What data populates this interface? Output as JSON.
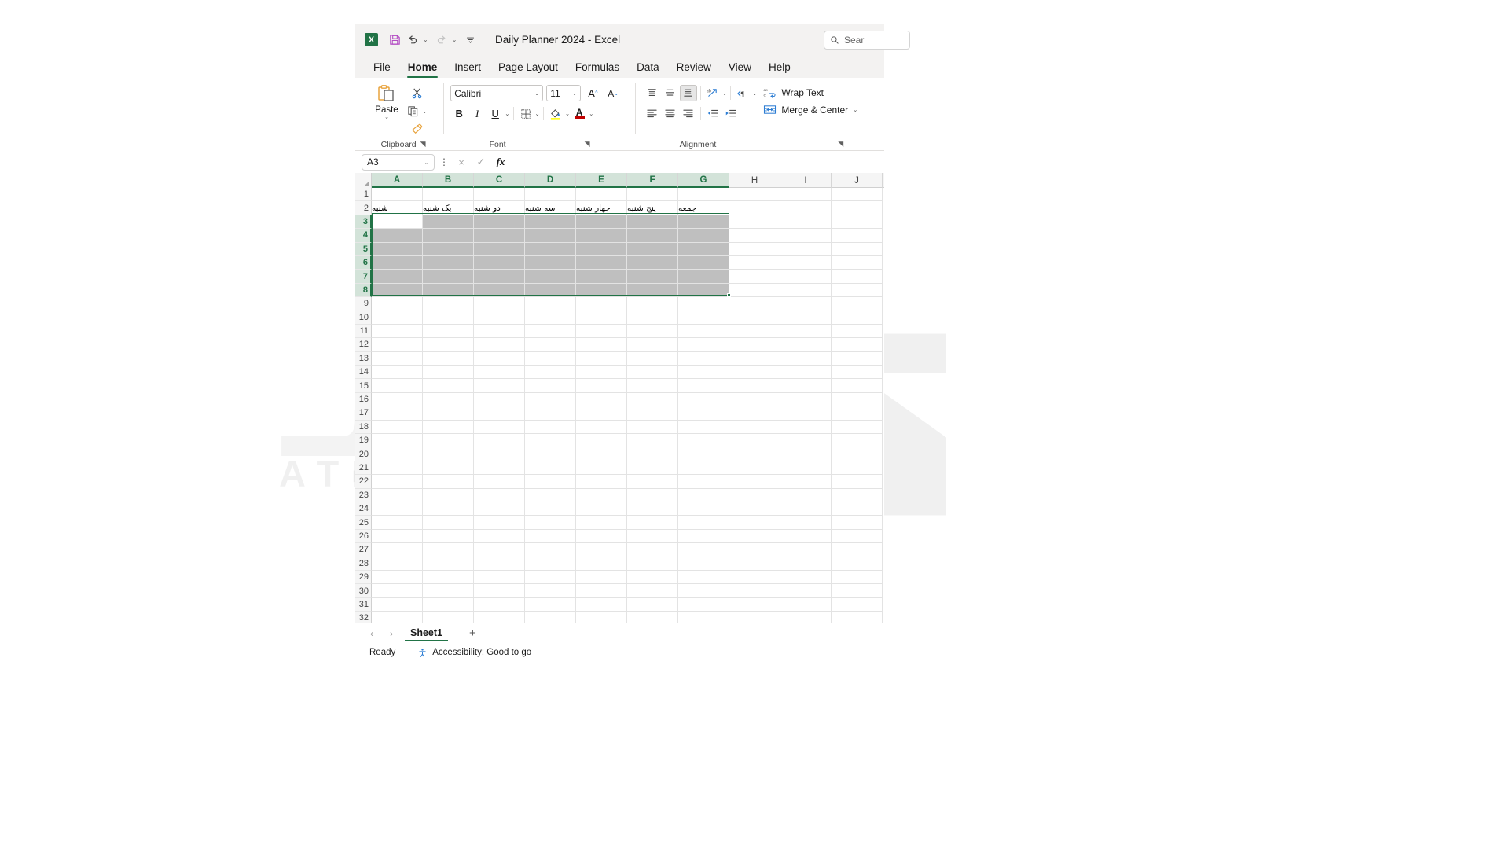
{
  "window": {
    "title": "Daily Planner 2024  -  Excel",
    "app_icon": "excel-icon",
    "app_icon_letter": "X"
  },
  "quick_access": {
    "save_label": "save-icon",
    "undo_label": "undo-icon",
    "redo_label": "redo-icon",
    "customize_label": "customize-quick-access-toolbar-icon"
  },
  "search": {
    "placeholder": "Sear",
    "text": "Sear",
    "icon": "search-icon"
  },
  "tabs": [
    {
      "label": "File",
      "active": false
    },
    {
      "label": "Home",
      "active": true
    },
    {
      "label": "Insert",
      "active": false
    },
    {
      "label": "Page Layout",
      "active": false
    },
    {
      "label": "Formulas",
      "active": false
    },
    {
      "label": "Data",
      "active": false
    },
    {
      "label": "Review",
      "active": false
    },
    {
      "label": "View",
      "active": false
    },
    {
      "label": "Help",
      "active": false
    }
  ],
  "ribbon": {
    "clipboard": {
      "group_label": "Clipboard",
      "paste_label": "Paste",
      "cut_label": "Cut",
      "copy_label": "Copy",
      "format_painter_label": "Format Painter"
    },
    "font": {
      "group_label": "Font",
      "font_name": "Calibri",
      "font_size": "11",
      "bold": "B",
      "italic": "I",
      "underline": "U",
      "grow_font": "A",
      "shrink_font": "A",
      "borders": "borders-icon",
      "fill_color": "fill-color-icon",
      "font_color": "A",
      "fill_color_swatch": "#ffff00",
      "font_color_swatch": "#c00000"
    },
    "alignment": {
      "group_label": "Alignment",
      "align_top": "align-top-icon",
      "align_middle": "align-middle-icon",
      "align_bottom": "align-bottom-icon",
      "orientation": "orientation-icon",
      "align_left": "align-left-icon",
      "align_center": "align-center-icon",
      "align_right": "align-right-icon",
      "decrease_indent": "decrease-indent-icon",
      "increase_indent": "increase-indent-icon",
      "wrap_text_label": "Wrap Text",
      "merge_center_label": "Merge & Center"
    }
  },
  "formula_bar": {
    "name_box": "A3",
    "cancel": "×",
    "enter": "✓",
    "function": "fx",
    "formula_value": ""
  },
  "grid": {
    "columns": [
      "A",
      "B",
      "C",
      "D",
      "E",
      "F",
      "G",
      "H",
      "I",
      "J"
    ],
    "selected_columns": [
      "A",
      "B",
      "C",
      "D",
      "E",
      "F",
      "G"
    ],
    "row_count": 33,
    "selected_rows": [
      3,
      4,
      5,
      6,
      7,
      8
    ],
    "selection_range": "A3:G8",
    "active_cell": "A3",
    "rows": [
      {
        "num": 1,
        "cells": [
          "",
          "",
          "",
          "",
          "",
          "",
          "",
          "",
          "",
          ""
        ]
      },
      {
        "num": 2,
        "cells": [
          "شنبه",
          "یک شنبه",
          "دو شنبه",
          "سه شنبه",
          "چهار شنبه",
          "پنج شنبه",
          "جمعه",
          "",
          "",
          ""
        ]
      },
      {
        "num": 3,
        "cells": [
          "",
          "",
          "",
          "",
          "",
          "",
          "",
          "",
          "",
          ""
        ]
      },
      {
        "num": 4,
        "cells": [
          "",
          "",
          "",
          "",
          "",
          "",
          "",
          "",
          "",
          ""
        ]
      },
      {
        "num": 5,
        "cells": [
          "",
          "",
          "",
          "",
          "",
          "",
          "",
          "",
          "",
          ""
        ]
      },
      {
        "num": 6,
        "cells": [
          "",
          "",
          "",
          "",
          "",
          "",
          "",
          "",
          "",
          ""
        ]
      },
      {
        "num": 7,
        "cells": [
          "",
          "",
          "",
          "",
          "",
          "",
          "",
          "",
          "",
          ""
        ]
      },
      {
        "num": 8,
        "cells": [
          "",
          "",
          "",
          "",
          "",
          "",
          "",
          "",
          "",
          ""
        ]
      }
    ]
  },
  "sheet_bar": {
    "prev_label": "‹",
    "next_label": "›",
    "sheets": [
      {
        "name": "Sheet1",
        "active": true
      }
    ],
    "add_sheet_label": "+"
  },
  "status_bar": {
    "mode": "Ready",
    "accessibility": "Accessibility: Good to go",
    "accessibility_icon": "accessibility-icon"
  },
  "watermark": {
    "text": "ATIO ACADEMY",
    "glyph": "آتیـ"
  },
  "colors": {
    "accent_green": "#217346",
    "header_bg": "#f3f2f1",
    "selection_fill": "#bfbfbf",
    "header_selected": "#d3e3d9"
  }
}
